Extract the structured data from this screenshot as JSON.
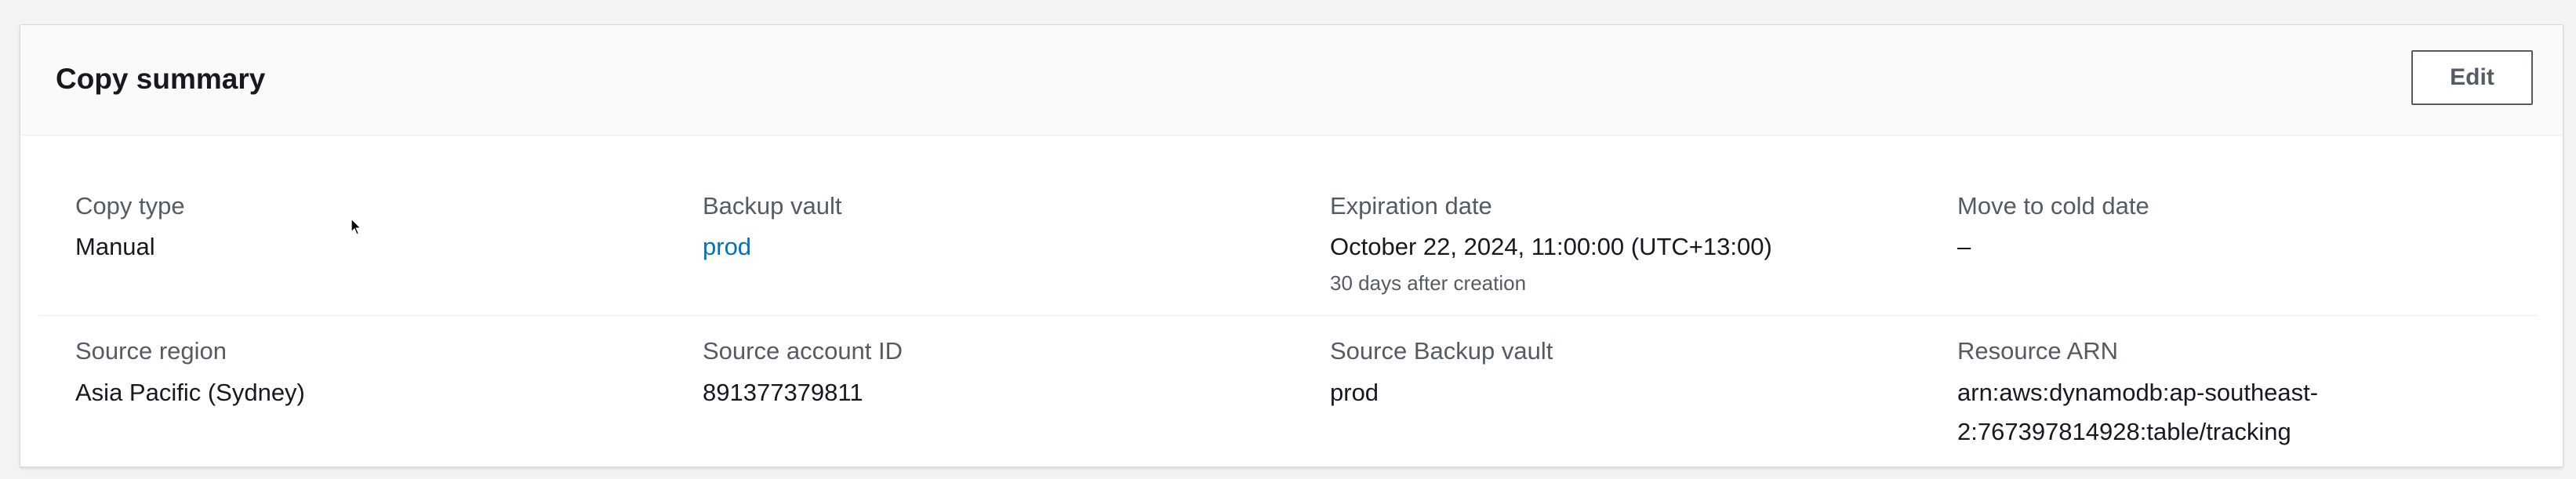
{
  "panel": {
    "title": "Copy summary",
    "edit_label": "Edit"
  },
  "fields": {
    "copy_type": {
      "label": "Copy type",
      "value": "Manual"
    },
    "backup_vault": {
      "label": "Backup vault",
      "value": "prod"
    },
    "expiration_date": {
      "label": "Expiration date",
      "value": "October 22, 2024, 11:00:00 (UTC+13:00)",
      "sub": "30 days after creation"
    },
    "move_to_cold_date": {
      "label": "Move to cold date",
      "value": "–"
    },
    "source_region": {
      "label": "Source region",
      "value": "Asia Pacific (Sydney)"
    },
    "source_account_id": {
      "label": "Source account ID",
      "value": "891377379811"
    },
    "source_backup_vault": {
      "label": "Source Backup vault",
      "value": "prod"
    },
    "resource_arn": {
      "label": "Resource ARN",
      "value": "arn:aws:dynamodb:ap-southeast-2:767397814928:table/tracking"
    }
  },
  "colors": {
    "link": "#0073bb",
    "label": "#545b64",
    "text": "#16191f"
  },
  "icons": {
    "cursor": "mouse-pointer-icon"
  }
}
